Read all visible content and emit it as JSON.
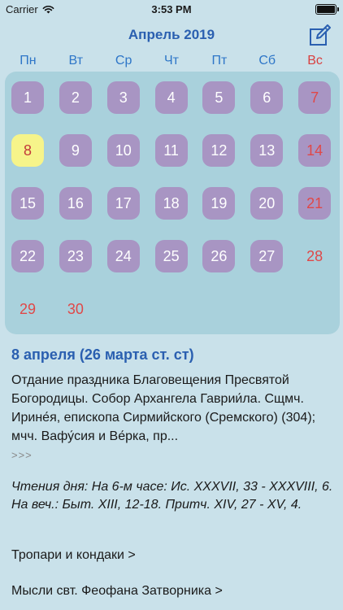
{
  "status_bar": {
    "carrier": "Carrier",
    "time": "3:53 PM",
    "icons": [
      "wifi-icon",
      "battery-icon"
    ]
  },
  "nav": {
    "title": "Апрель 2019",
    "edit_icon": "edit-icon"
  },
  "calendar": {
    "weekdays": [
      "Пн",
      "Вт",
      "Ср",
      "Чт",
      "Пт",
      "Сб",
      "Вс"
    ],
    "days": [
      {
        "label": "1",
        "style": "filled"
      },
      {
        "label": "2",
        "style": "filled"
      },
      {
        "label": "3",
        "style": "filled"
      },
      {
        "label": "4",
        "style": "filled"
      },
      {
        "label": "5",
        "style": "filled"
      },
      {
        "label": "6",
        "style": "filled"
      },
      {
        "label": "7",
        "style": "filled"
      },
      {
        "label": "8",
        "style": "today"
      },
      {
        "label": "9",
        "style": "filled"
      },
      {
        "label": "10",
        "style": "filled"
      },
      {
        "label": "11",
        "style": "filled"
      },
      {
        "label": "12",
        "style": "filled"
      },
      {
        "label": "13",
        "style": "filled"
      },
      {
        "label": "14",
        "style": "filled"
      },
      {
        "label": "15",
        "style": "filled"
      },
      {
        "label": "16",
        "style": "filled"
      },
      {
        "label": "17",
        "style": "filled"
      },
      {
        "label": "18",
        "style": "filled"
      },
      {
        "label": "19",
        "style": "filled"
      },
      {
        "label": "20",
        "style": "filled"
      },
      {
        "label": "21",
        "style": "filled"
      },
      {
        "label": "22",
        "style": "filled"
      },
      {
        "label": "23",
        "style": "filled"
      },
      {
        "label": "24",
        "style": "filled"
      },
      {
        "label": "25",
        "style": "filled"
      },
      {
        "label": "26",
        "style": "filled"
      },
      {
        "label": "27",
        "style": "filled"
      },
      {
        "label": "28",
        "style": "empty"
      },
      {
        "label": "29",
        "style": "empty"
      },
      {
        "label": "30",
        "style": "empty"
      }
    ],
    "colors": {
      "filled": "#a895c3",
      "today": "#f6f48a",
      "sunday_text": "#e04848",
      "panel": "#a9d1dc"
    }
  },
  "detail": {
    "date_heading": "8 апреля (26 марта ст. ст)",
    "feast_text": "Отдание праздника Благовещения Пресвятой Богородицы. Собор Архангела Гаврии́ла. Сщмч. Ирине́я, епископа Сирмийского (Сремского) (304); мчч. Вафу́сия и Ве́рка, пр...",
    "more_label": ">>>",
    "readings": "Чтения дня: На 6-м часе: Ис. XXXVII, 33 - XXXVIII, 6. На веч.: Быт. XIII, 12-18. Притч. XIV, 27 - XV, 4.",
    "troparia_link": "Тропари и кондаки >",
    "theophan_link": "Мысли свт. Феофана Затворника >"
  }
}
